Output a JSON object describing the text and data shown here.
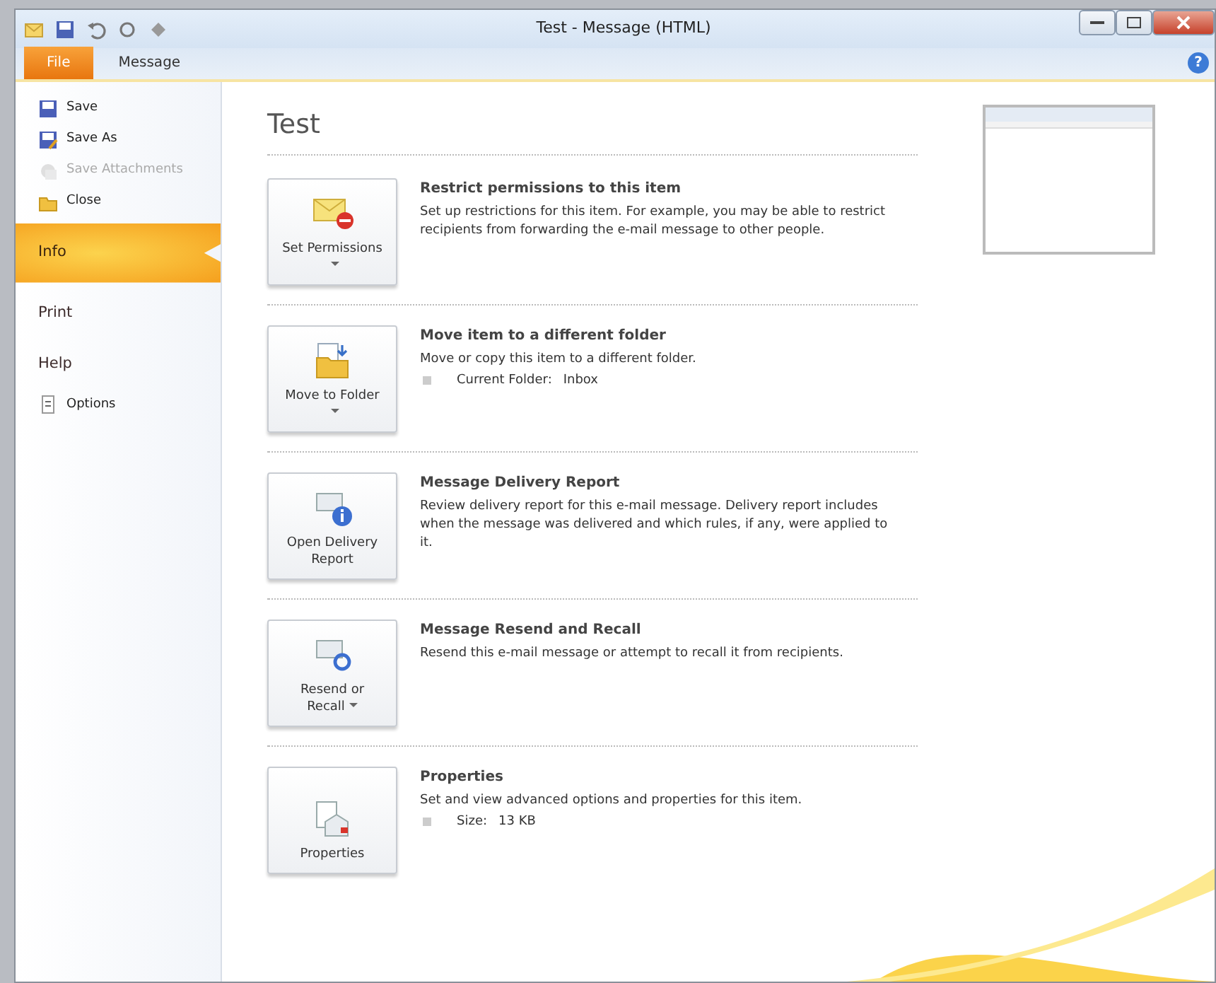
{
  "window": {
    "title": "Test - Message (HTML)",
    "help": "?"
  },
  "tabs": [
    {
      "label": "File",
      "selected": true
    },
    {
      "label": "Message",
      "selected": false
    }
  ],
  "sidebar": {
    "items": [
      {
        "label": "Save",
        "kind": "command",
        "disabled": false,
        "selected": false
      },
      {
        "label": "Save As",
        "kind": "command",
        "disabled": false,
        "selected": false
      },
      {
        "label": "Save Attachments",
        "kind": "command",
        "disabled": true,
        "selected": false
      },
      {
        "label": "Close",
        "kind": "command",
        "disabled": false,
        "selected": false
      },
      {
        "label": "Info",
        "kind": "page",
        "selected": true,
        "disabled": false
      },
      {
        "label": "Print",
        "kind": "page",
        "selected": false,
        "disabled": false
      },
      {
        "label": "Help",
        "kind": "page",
        "selected": false,
        "disabled": false
      },
      {
        "label": "Options",
        "kind": "command",
        "disabled": false,
        "selected": false
      }
    ]
  },
  "info": {
    "title": "Test",
    "sections": [
      {
        "button": "Set Permissions",
        "dropdown": true,
        "heading": "Restrict permissions to this item",
        "description": "Set up restrictions for this item. For example, you may be able to restrict recipients from forwarding the e-mail message to other people."
      },
      {
        "button": "Move to Folder",
        "dropdown": true,
        "heading": "Move item to a different folder",
        "description": "Move or copy this item to a different folder.",
        "detail": {
          "label": "Current Folder:",
          "value": "Inbox"
        }
      },
      {
        "button": "Open Delivery Report",
        "dropdown": false,
        "heading": "Message Delivery Report",
        "description": "Review delivery report for this e-mail message. Delivery report includes when the message was delivered and which rules, if any, were applied to it."
      },
      {
        "button": "Resend or Recall",
        "dropdown": true,
        "heading": "Message Resend and Recall",
        "description": "Resend this e-mail message or attempt to recall it from recipients."
      },
      {
        "button": "Properties",
        "dropdown": false,
        "heading": "Properties",
        "description": "Set and view advanced options and properties for this item.",
        "detail": {
          "label": "Size:",
          "value": "13 KB"
        }
      }
    ]
  }
}
